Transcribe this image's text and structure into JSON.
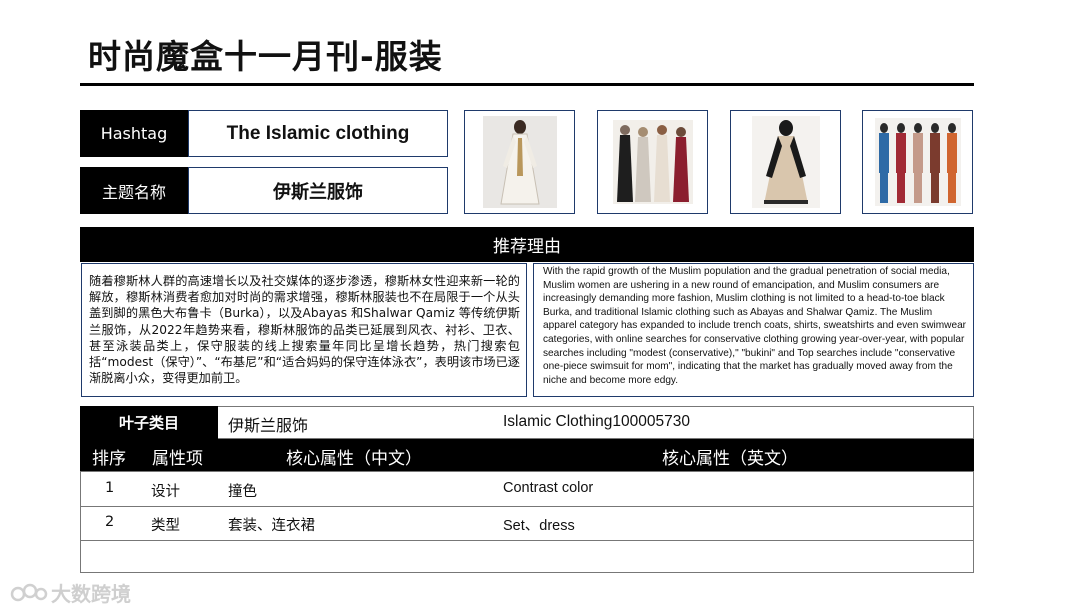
{
  "page": {
    "title": "时尚魔盒十一月刊-服装"
  },
  "header": {
    "hashtag_label": "Hashtag",
    "hashtag_value": "The Islamic clothing",
    "theme_label": "主题名称",
    "theme_value": "伊斯兰服饰"
  },
  "thumbnails": [
    {
      "icon": "white-abaya-model-photo"
    },
    {
      "icon": "four-women-abayas-photo"
    },
    {
      "icon": "beige-black-abaya-photo"
    },
    {
      "icon": "five-women-shalwar-sets-photo"
    }
  ],
  "reason": {
    "heading": "推荐理由",
    "chinese": "随着穆斯林人群的高速增长以及社交媒体的逐步渗透，穆斯林女性迎来新一轮的解放，穆斯林消费者愈加对时尚的需求增强，穆斯林服装也不在局限于一个从头盖到脚的黑色大布鲁卡（Burka），以及Abayas 和Shalwar Qamiz 等传统伊斯兰服饰，从2022年趋势来看，穆斯林服饰的品类已延展到风衣、衬衫、卫衣、甚至泳装品类上，保守服装的线上搜索量年同比呈增长趋势，热门搜索包括“modest（保守）”、“布基尼”和“适合妈妈的保守连体泳衣”，表明该市场已逐渐脱离小众，变得更加前卫。",
    "english": "With the rapid growth of the Muslim population and the gradual penetration of social media, Muslim women are ushering in a new round of emancipation, and Muslim consumers are increasingly demanding more fashion, Muslim clothing is not limited to a head-to-toe black Burka, and traditional Islamic clothing such as Abayas and Shalwar Qamiz. The Muslim apparel category has expanded to include trench coats, shirts, sweatshirts and even swimwear categories, with online searches for conservative clothing growing year-over-year, with popular searches including \"modest (conservative),\" \"bukini\" and Top searches include \"conservative one-piece swimsuit for mom\", indicating that the market has gradually moved away from the niche and become more edgy."
  },
  "leaf": {
    "label": "叶子类目",
    "cn": "伊斯兰服饰",
    "en": "Islamic Clothing100005730"
  },
  "table": {
    "headers": [
      "排序",
      "属性项",
      "核心属性（中文）",
      "核心属性（英文）"
    ],
    "rows": [
      {
        "rank": "1",
        "attr": "设计",
        "cn": "撞色",
        "en": "Contrast color"
      },
      {
        "rank": "2",
        "attr": "类型",
        "cn": "套装、连衣裙",
        "en": "Set、dress"
      }
    ]
  },
  "watermark": {
    "text": "大数跨境",
    "icon": "dashu-logo-icon"
  }
}
